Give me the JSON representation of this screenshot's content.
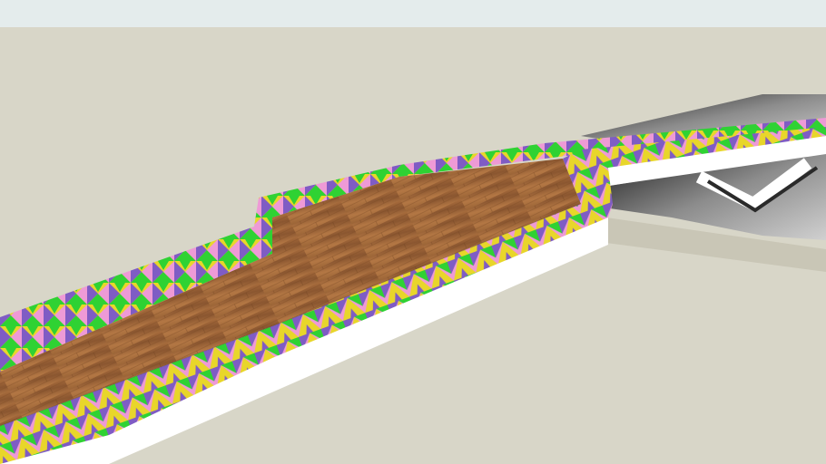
{
  "scene": {
    "sky_color": "#e4ecec",
    "ground_color": "#d8d6c8",
    "ground_shadow_color": "#c9c6b6",
    "base_color": "#ffffff",
    "deck_colors": [
      "#9a6436",
      "#b37744",
      "#8a5630",
      "#a86c3c"
    ],
    "pattern_colors": [
      "#e8d62a",
      "#7f5cc4",
      "#2fd233",
      "#ee9ad6"
    ],
    "road_colors": [
      "#1e1e1e",
      "#8c8c8c",
      "#d0d0d0"
    ]
  }
}
